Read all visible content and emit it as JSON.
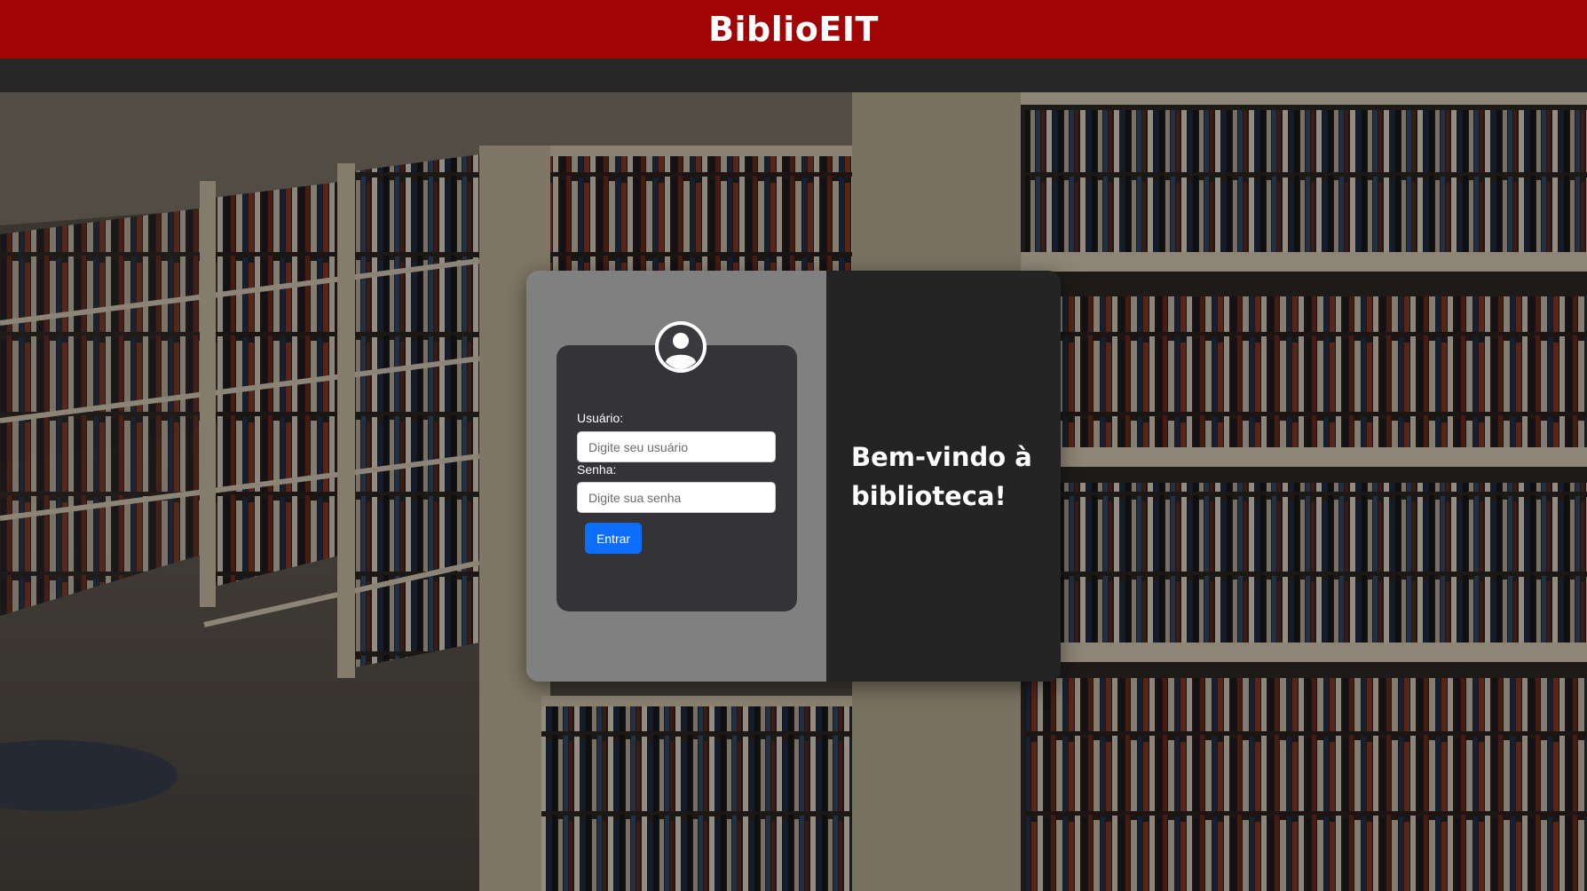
{
  "header": {
    "title": "BiblioEIT"
  },
  "login": {
    "username_label": "Usuário:",
    "username_placeholder": "Digite seu usuário",
    "password_label": "Senha:",
    "password_placeholder": "Digite sua senha",
    "submit_label": "Entrar"
  },
  "welcome": {
    "message": "Bem-vindo à biblioteca!"
  },
  "colors": {
    "header_bg": "#a00404",
    "navbar_bg": "#272727",
    "card_left_bg": "#808080",
    "card_right_bg": "#242424",
    "form_bg": "#343438",
    "button_bg": "#0d6efd"
  },
  "icons": {
    "avatar": "user-circle-icon"
  }
}
